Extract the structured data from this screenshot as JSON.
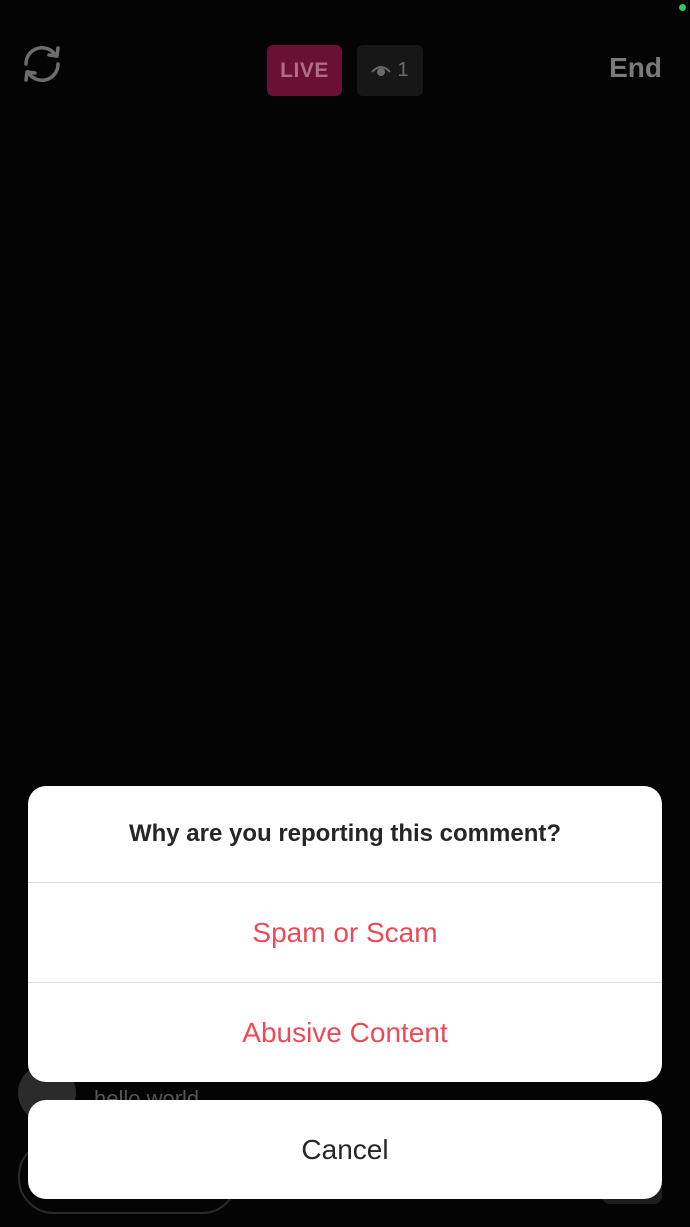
{
  "topbar": {
    "live_label": "LIVE",
    "viewer_count": "1",
    "end_label": "End"
  },
  "background": {
    "comment_text": "hello world"
  },
  "report_sheet": {
    "title": "Why are you reporting this comment?",
    "options": [
      {
        "label": "Spam or Scam"
      },
      {
        "label": "Abusive Content"
      }
    ],
    "cancel_label": "Cancel"
  },
  "colors": {
    "destructive": "#ed4956",
    "live_badge": "#6a1034"
  },
  "icons": [
    "switch-camera-icon",
    "eye-icon"
  ]
}
